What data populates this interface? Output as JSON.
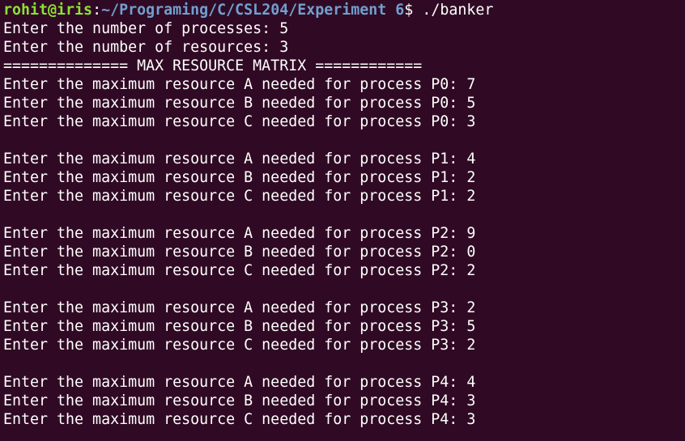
{
  "prompt": {
    "user_host": "rohit@iris",
    "separator": ":",
    "path": "~/Programing/C/CSL204/Experiment 6",
    "dollar": "$ ",
    "command": "./banker"
  },
  "output_lines": [
    "Enter the number of processes: 5",
    "Enter the number of resources: 3",
    "============== MAX RESOURCE MATRIX ============",
    "Enter the maximum resource A needed for process P0: 7",
    "Enter the maximum resource B needed for process P0: 5",
    "Enter the maximum resource C needed for process P0: 3",
    "",
    "Enter the maximum resource A needed for process P1: 4",
    "Enter the maximum resource B needed for process P1: 2",
    "Enter the maximum resource C needed for process P1: 2",
    "",
    "Enter the maximum resource A needed for process P2: 9",
    "Enter the maximum resource B needed for process P2: 0",
    "Enter the maximum resource C needed for process P2: 2",
    "",
    "Enter the maximum resource A needed for process P3: 2",
    "Enter the maximum resource B needed for process P3: 5",
    "Enter the maximum resource C needed for process P3: 2",
    "",
    "Enter the maximum resource A needed for process P4: 4",
    "Enter the maximum resource B needed for process P4: 3",
    "Enter the maximum resource C needed for process P4: 3"
  ],
  "colors": {
    "background": "#300a24",
    "text": "#ffffff",
    "prompt_user": "#8ae234",
    "prompt_path": "#729fcf"
  }
}
